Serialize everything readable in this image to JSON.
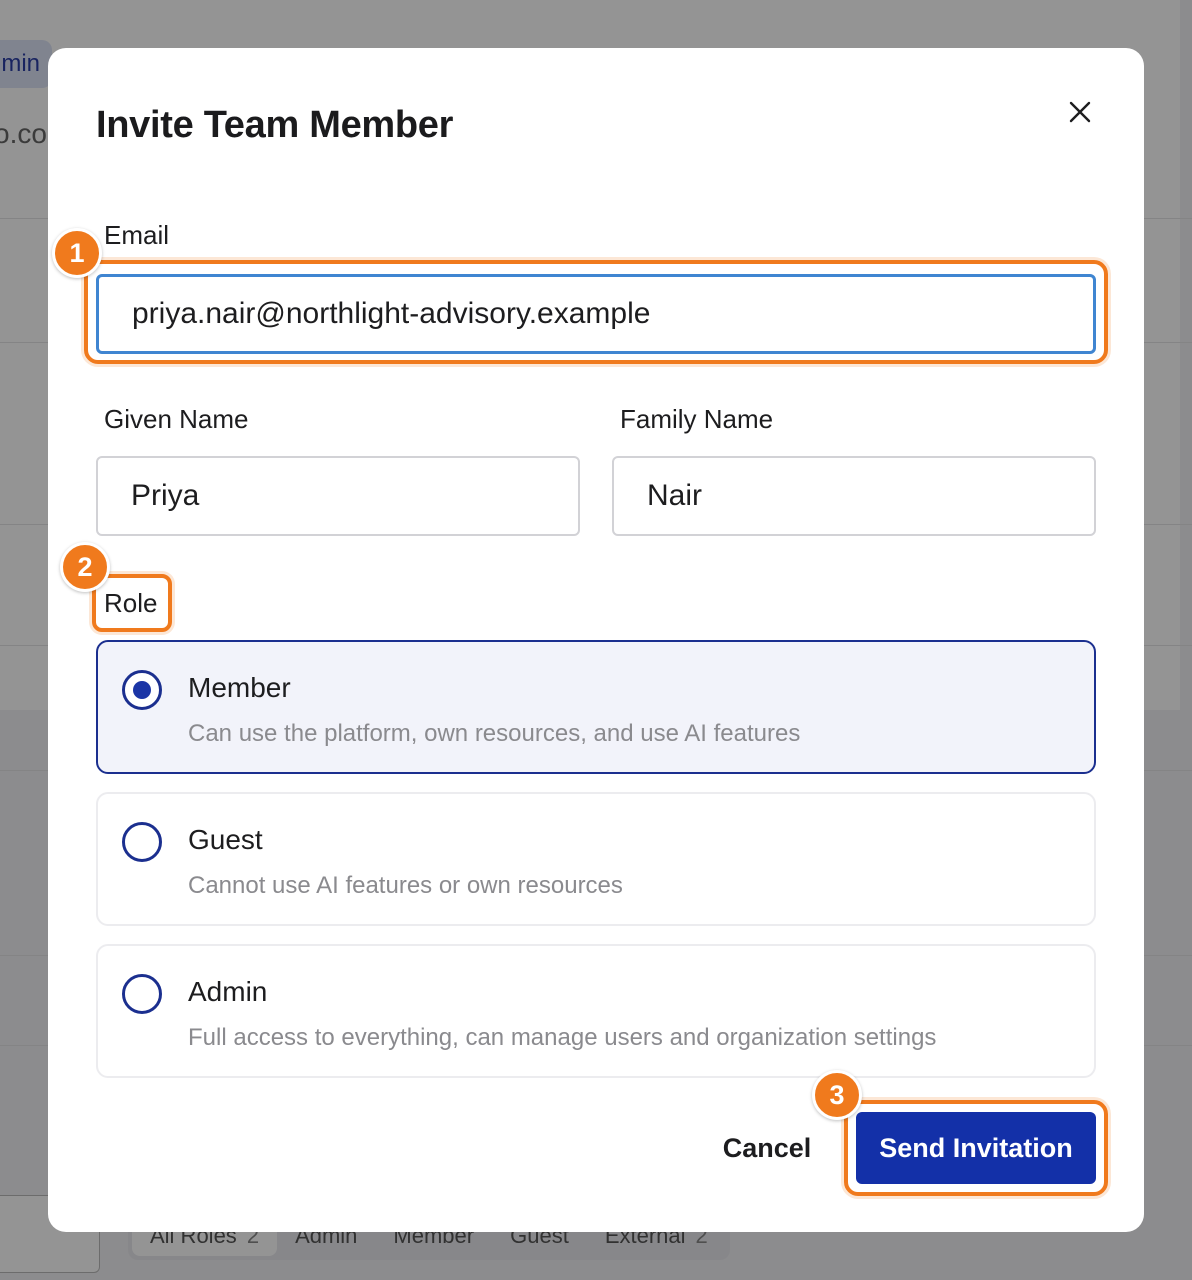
{
  "background": {
    "badge_text": "min",
    "email_fragment": "o.co",
    "tabs": [
      {
        "label": "All Roles",
        "count": "2"
      },
      {
        "label": "Admin",
        "count": ""
      },
      {
        "label": "Member",
        "count": ""
      },
      {
        "label": "Guest",
        "count": ""
      },
      {
        "label": "External",
        "count": "2"
      }
    ]
  },
  "modal": {
    "title": "Invite Team Member",
    "close_icon": "close-icon",
    "email": {
      "label": "Email",
      "value": "priya.nair@northlight-advisory.example"
    },
    "given_name": {
      "label": "Given Name",
      "value": "Priya"
    },
    "family_name": {
      "label": "Family Name",
      "value": "Nair"
    },
    "role": {
      "label": "Role",
      "selected": "Member",
      "options": [
        {
          "name": "Member",
          "description": "Can use the platform, own resources, and use AI features"
        },
        {
          "name": "Guest",
          "description": "Cannot use AI features or own resources"
        },
        {
          "name": "Admin",
          "description": "Full access to everything, can manage users and organization settings"
        }
      ]
    },
    "buttons": {
      "cancel": "Cancel",
      "send": "Send Invitation"
    }
  },
  "annotations": [
    "1",
    "2",
    "3"
  ],
  "colors": {
    "accent": "#1330a8",
    "highlight": "#f07a1d",
    "focus": "#3f85d1"
  }
}
